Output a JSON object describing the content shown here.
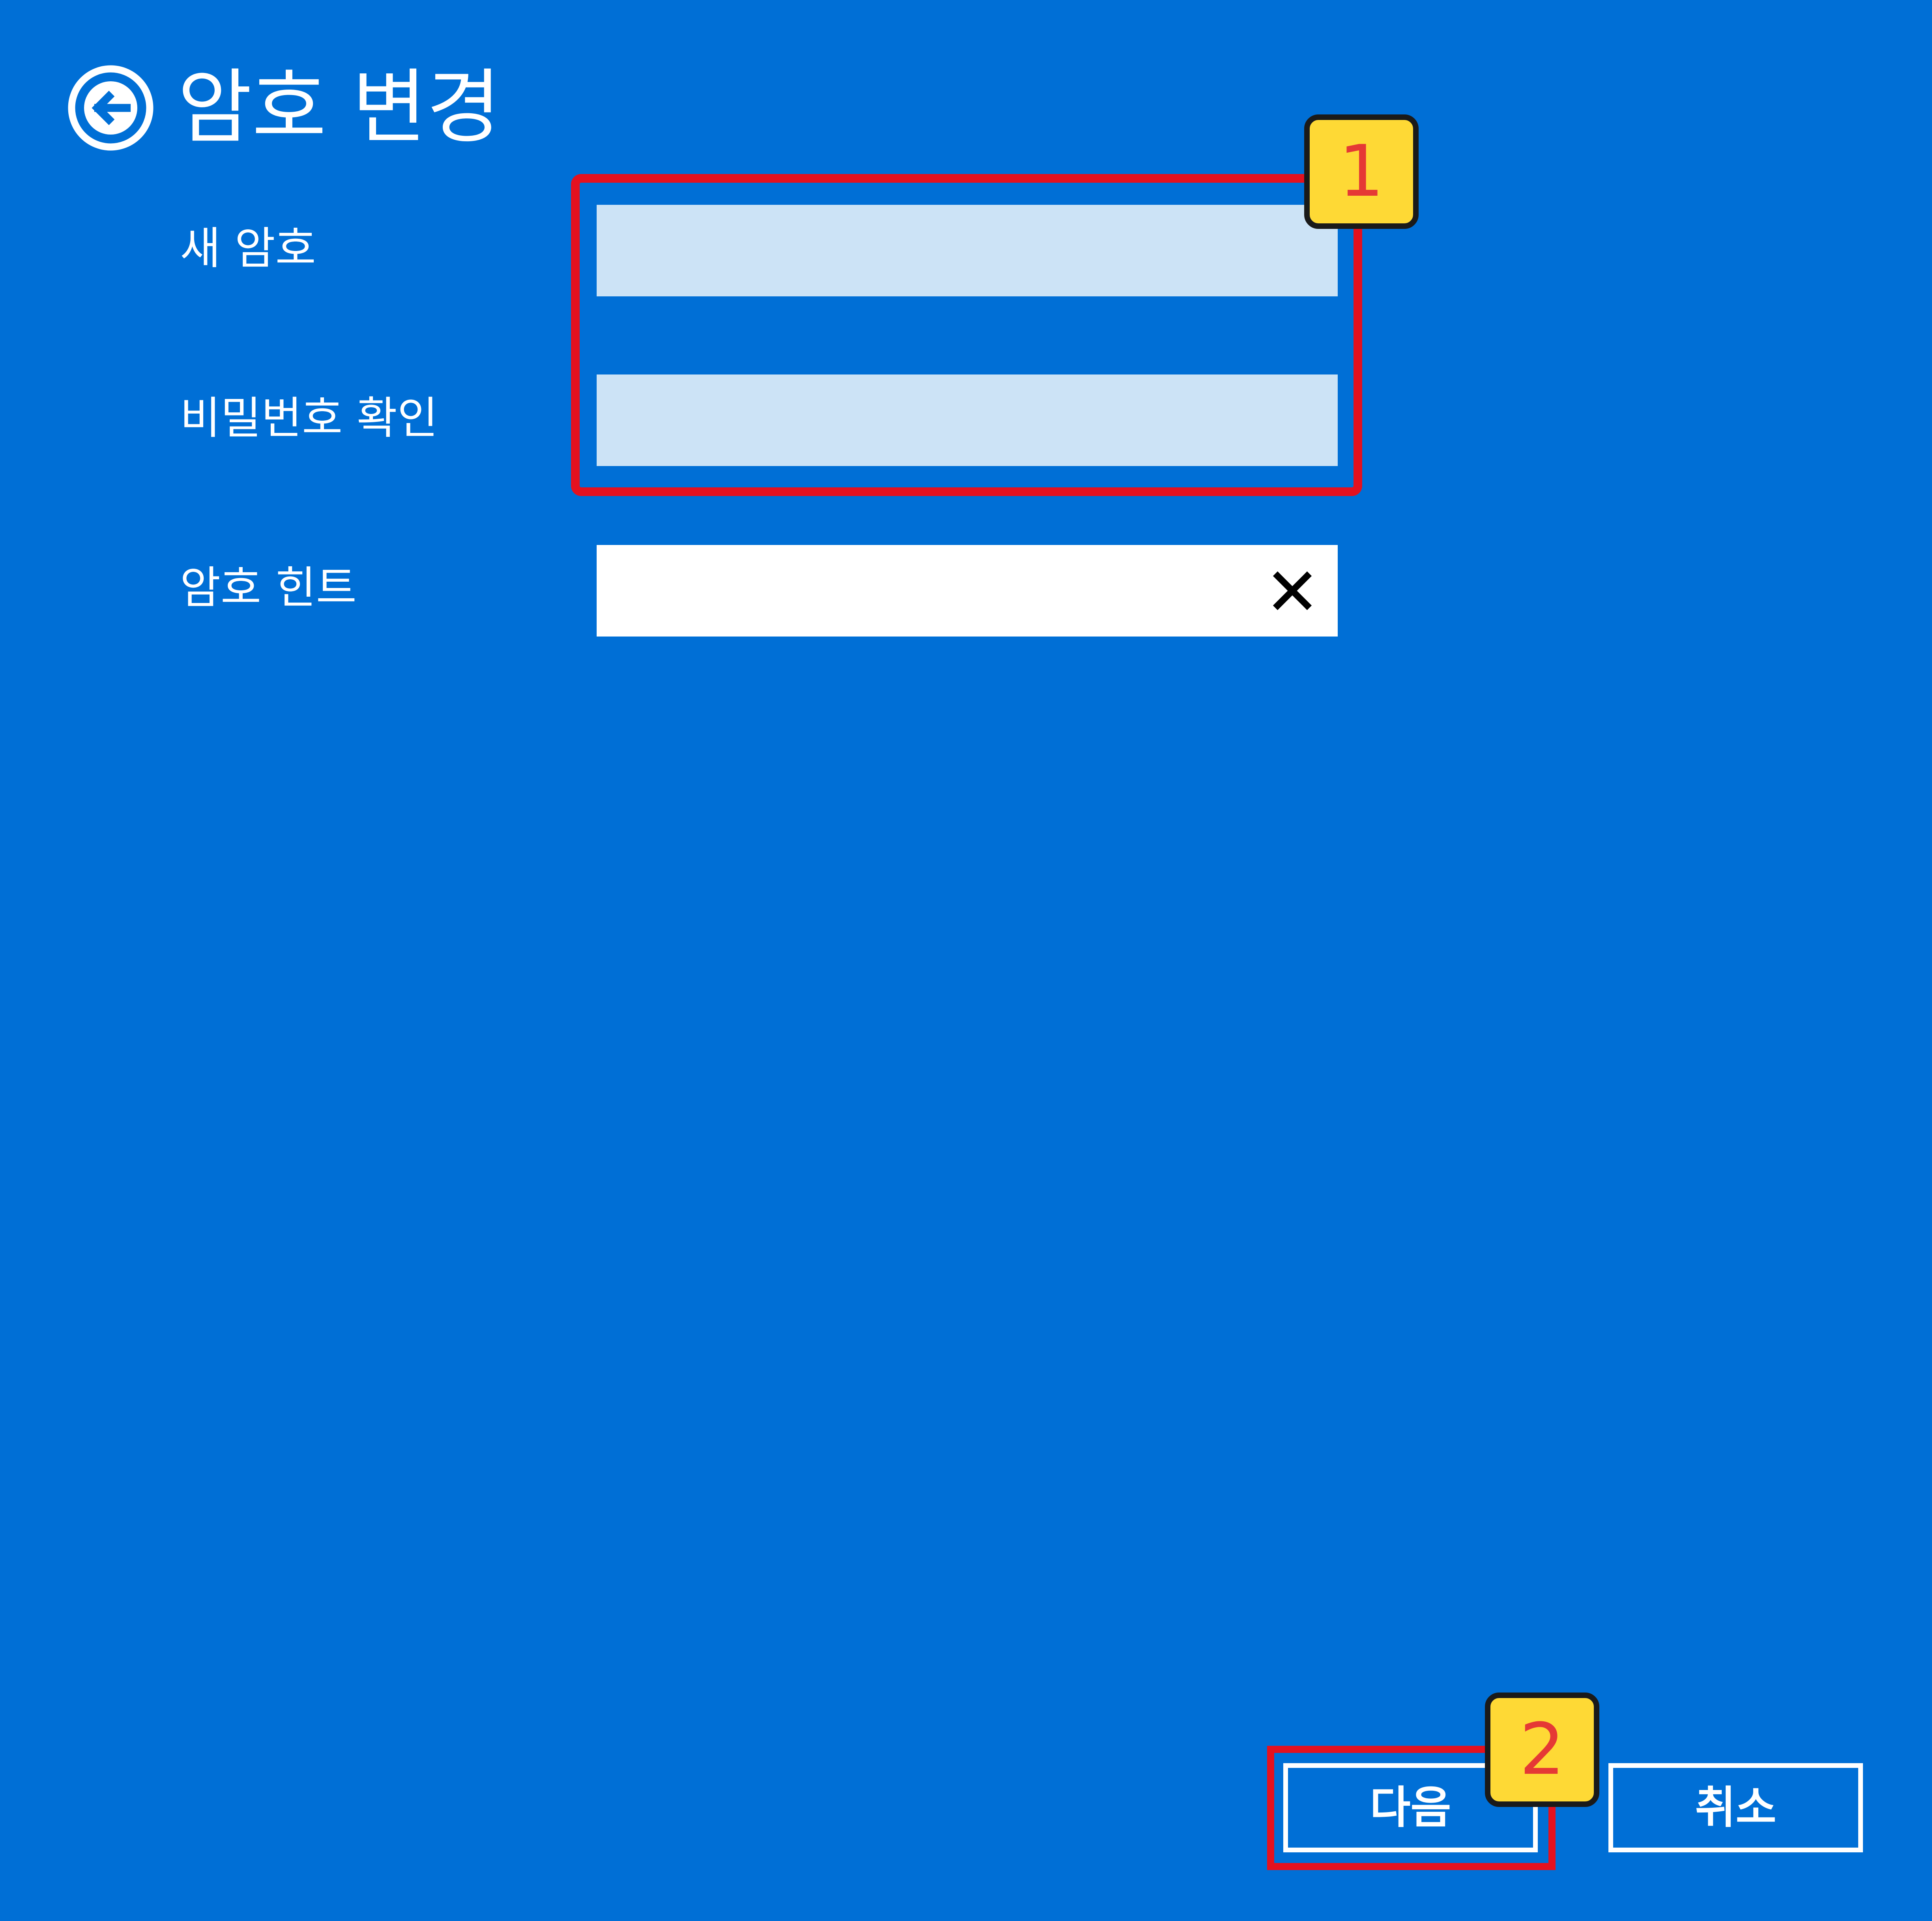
{
  "header": {
    "title": "암호 변경",
    "back_icon": "arrow-left-circle-icon"
  },
  "form": {
    "new_password": {
      "label": "새 암호",
      "value": ""
    },
    "confirm_password": {
      "label": "비밀번호 확인",
      "value": ""
    },
    "hint": {
      "label": "암호 힌트",
      "value": "",
      "clear_icon": "close-icon"
    }
  },
  "annotations": {
    "step1": "1",
    "step2": "2"
  },
  "buttons": {
    "next_label": "다음",
    "cancel_label": "취소"
  },
  "colors": {
    "background": "#006FD6",
    "input_fill": "#CCE3F6",
    "highlight": "#E4111F",
    "badge_fill": "#FED935",
    "badge_text": "#E53935"
  }
}
